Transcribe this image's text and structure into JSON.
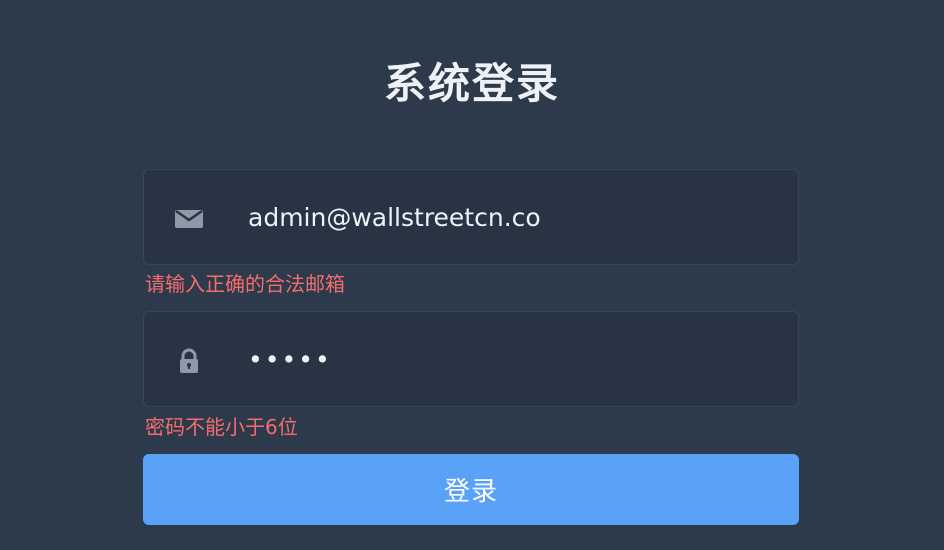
{
  "title": "系统登录",
  "email_field": {
    "icon": "mail-icon",
    "value": "admin@wallstreetcn.co",
    "error": "请输入正确的合法邮箱"
  },
  "password_field": {
    "icon": "lock-icon",
    "value": "•••••",
    "error": "密码不能小于6位"
  },
  "login_button": {
    "label": "登录"
  },
  "colors": {
    "background": "#2d3a4b",
    "field_background": "#283443",
    "error": "#f56c6c",
    "primary": "#5aa2f7"
  }
}
